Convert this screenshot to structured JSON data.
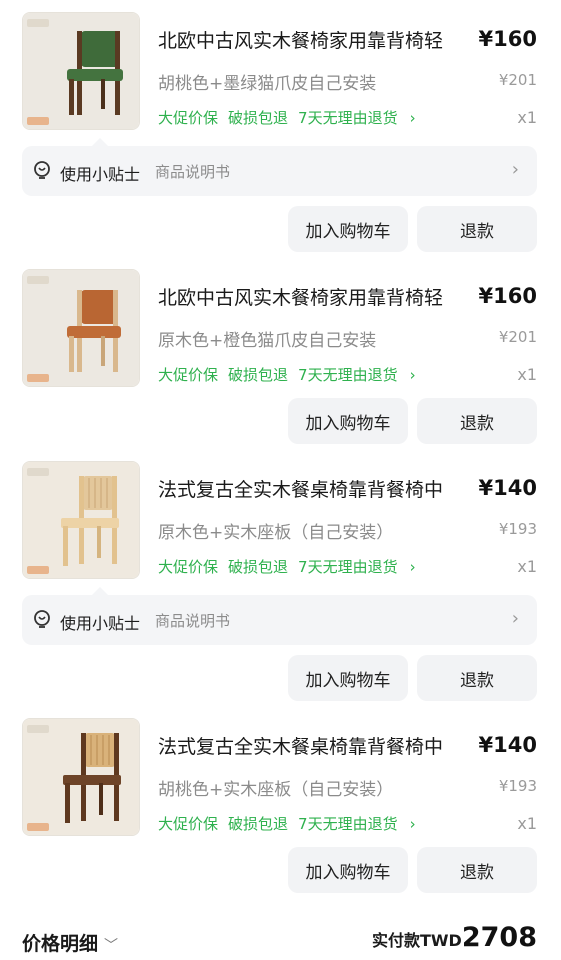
{
  "items": [
    {
      "title": "北欧中古风实木餐椅家用靠背椅轻",
      "price": "¥160",
      "spec": "胡桃色+墨绿猫爪皮自己安装",
      "original_price": "¥201",
      "tags": [
        "大促价保",
        "破损包退",
        "7天无理由退货"
      ],
      "quantity": "x1",
      "image_icon": "chair-walnut-green-icon"
    },
    {
      "title": "北欧中古风实木餐椅家用靠背椅轻",
      "price": "¥160",
      "spec": "原木色+橙色猫爪皮自己安装",
      "original_price": "¥201",
      "tags": [
        "大促价保",
        "破损包退",
        "7天无理由退货"
      ],
      "quantity": "x1",
      "image_icon": "chair-oak-orange-icon"
    },
    {
      "title": "法式复古全实木餐桌椅靠背餐椅中",
      "price": "¥140",
      "spec": "原木色+实木座板（自己安装）",
      "original_price": "¥193",
      "tags": [
        "大促价保",
        "破损包退",
        "7天无理由退货"
      ],
      "quantity": "x1",
      "image_icon": "chair-oak-rattan-icon"
    },
    {
      "title": "法式复古全实木餐桌椅靠背餐椅中",
      "price": "¥140",
      "spec": "胡桃色+实木座板（自己安装）",
      "original_price": "¥193",
      "tags": [
        "大促价保",
        "破损包退",
        "7天无理由退货"
      ],
      "quantity": "x1",
      "image_icon": "chair-walnut-rattan-icon"
    }
  ],
  "tip": {
    "label": "使用小贴士",
    "sub": "商品说明书",
    "arrow": "›"
  },
  "buttons": {
    "add_cart": "加入购物车",
    "refund": "退款"
  },
  "tag_chevron": "›",
  "footer": {
    "price_detail": "价格明细",
    "dropdown": "﹀",
    "paid_label": "实付款TWD",
    "paid_amount": "2708"
  },
  "colors": {
    "tag_green": "#2fb14e",
    "button_bg": "#f2f3f5",
    "tip_bg": "#f4f5f7"
  }
}
